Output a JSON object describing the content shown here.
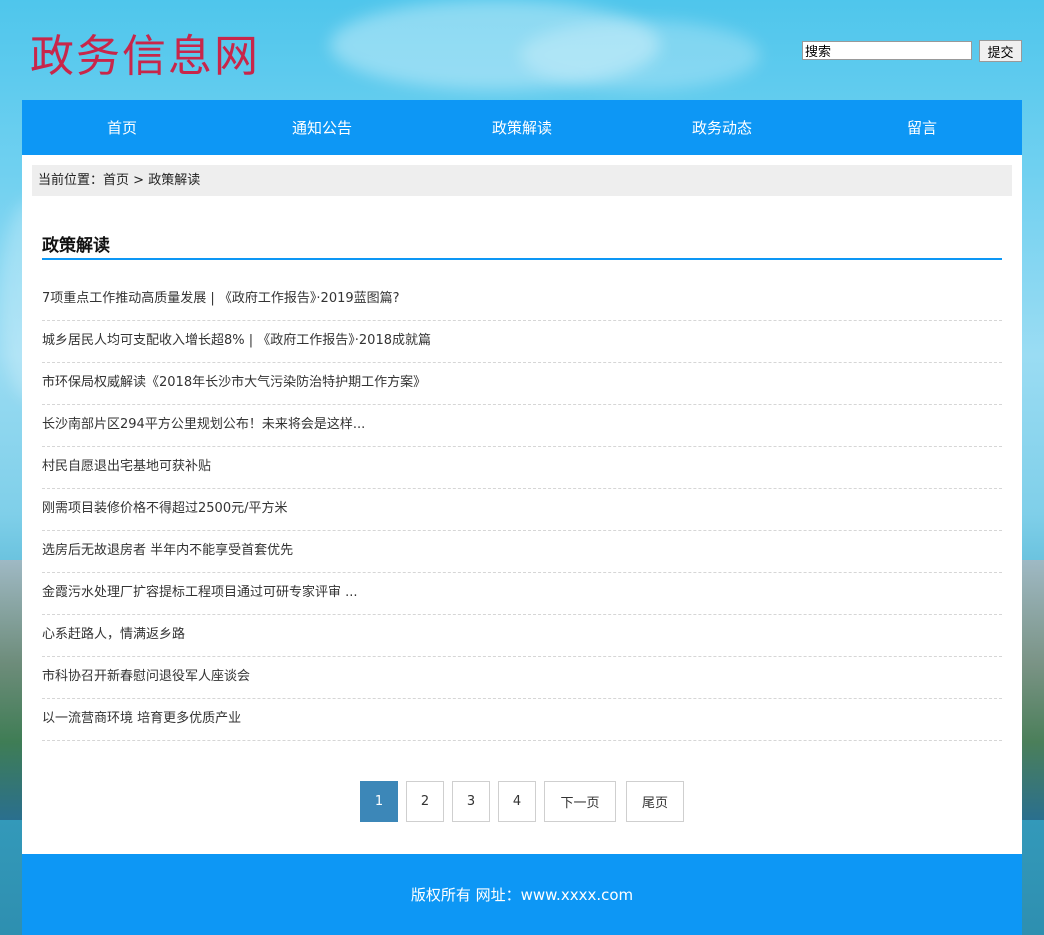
{
  "site": {
    "logo_text": "政务信息网"
  },
  "search": {
    "value": "搜索",
    "button_label": "提交"
  },
  "nav": {
    "items": [
      "首页",
      "通知公告",
      "政策解读",
      "政务动态",
      "留言"
    ]
  },
  "breadcrumb": {
    "prefix": "当前位置：",
    "home": "首页",
    "separator": " > ",
    "current": "政策解读"
  },
  "section": {
    "title": "政策解读"
  },
  "articles": [
    "7项重点工作推动高质量发展 | 《政府工作报告》·2019蓝图篇?",
    "城乡居民人均可支配收入增长超8% | 《政府工作报告》·2018成就篇",
    "市环保局权威解读《2018年长沙市大气污染防治特护期工作方案》",
    "长沙南部片区294平方公里规划公布！未来将会是这样...",
    "村民自愿退出宅基地可获补贴",
    "刚需项目装修价格不得超过2500元/平方米",
    "选房后无故退房者 半年内不能享受首套优先",
    "金霞污水处理厂扩容提标工程项目通过可研专家评审 ...",
    "心系赶路人，情满返乡路",
    "市科协召开新春慰问退役军人座谈会",
    "以一流营商环境 培育更多优质产业"
  ],
  "pagination": {
    "pages": [
      "1",
      "2",
      "3",
      "4"
    ],
    "current": "1",
    "next_label": "下一页",
    "last_label": "尾页"
  },
  "footer": {
    "text": "版权所有 网址：www.xxxx.com"
  },
  "colors": {
    "nav_bg": "#0d97f5",
    "logo": "#c8264a",
    "pager_active": "#3c87b8"
  }
}
